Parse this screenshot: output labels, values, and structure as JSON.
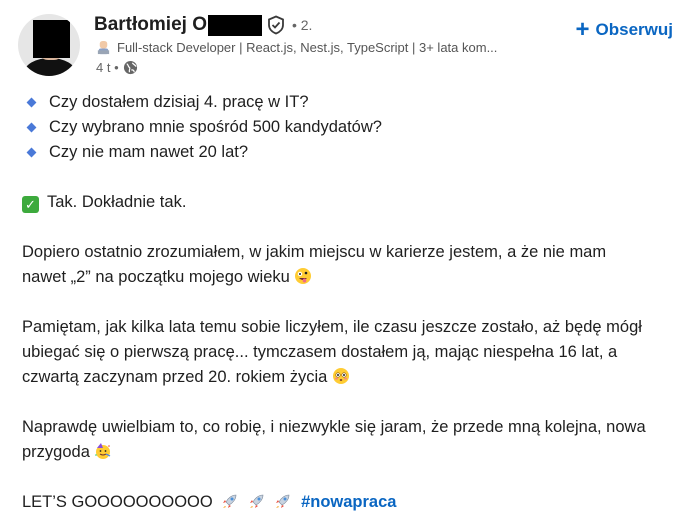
{
  "author": {
    "name_visible": "Bartłomiej O",
    "degree": "• 2.",
    "headline": "Full-stack Developer | React.js, Nest.js, TypeScript | 3+ lata kom...",
    "time": "4 t •"
  },
  "follow_label": "Obserwuj",
  "post": {
    "questions": [
      "Czy dostałem dzisiaj 4. pracę w IT?",
      "Czy wybrano mnie spośród 500 kandydatów?",
      "Czy nie mam nawet 20 lat?"
    ],
    "answer": "Tak. Dokładnie tak.",
    "para1_line1": "Dopiero ostatnio zrozumiałem, w jakim miejscu w karierze jestem, a że nie mam",
    "para1_line2": "nawet „2” na początku mojego wieku",
    "para2_line1": "Pamiętam, jak kilka lata temu sobie liczyłem, ile czasu jeszcze zostało, aż będę mógł",
    "para2_line2": "ubiegać się o pierwszą pracę... tymczasem dostałem ją, mając niespełna 16 lat, a",
    "para2_line3": "czwartą zaczynam przed 20. rokiem życia",
    "para3_line1": "Naprawdę uwielbiam to, co robię, i niezwykle się jaram, że przede mną kolejna, nowa",
    "para3_line2": "przygoda",
    "final": "LET’S GOOOOOOOOOO",
    "hashtag": "#nowapraca"
  },
  "icons": {
    "verified": "shield-check-icon",
    "globe": "globe-icon",
    "headline_emoji": "developer-emoji-icon",
    "bullet": "blue-diamond-icon",
    "check": "check-mark-button-icon",
    "zany": "zany-face-emoji",
    "flushed": "flushed-face-emoji",
    "party": "partying-face-emoji",
    "rocket": "rocket-emoji"
  },
  "colors": {
    "accent": "#0a66c2",
    "bullet": "#4a79d8",
    "check": "#3daa3d"
  }
}
